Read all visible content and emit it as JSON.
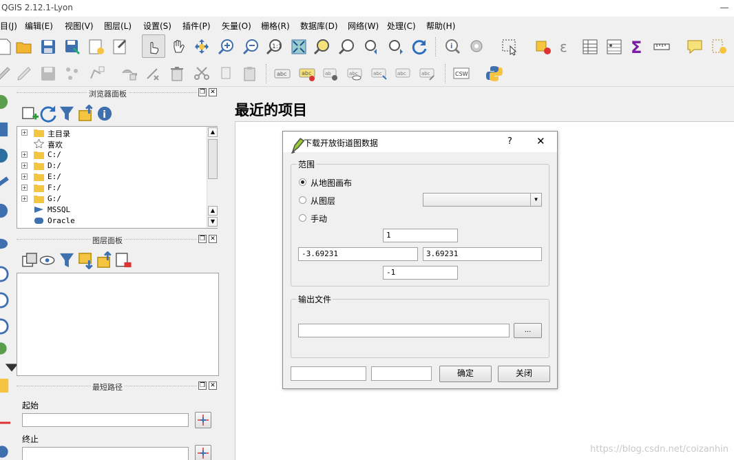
{
  "window": {
    "title": "QGIS 2.12.1-Lyon"
  },
  "menu": [
    {
      "label": "目(J)"
    },
    {
      "label": "编辑(E)"
    },
    {
      "label": "视图(V)"
    },
    {
      "label": "图层(L)"
    },
    {
      "label": "设置(S)"
    },
    {
      "label": "插件(P)"
    },
    {
      "label": "矢量(O)"
    },
    {
      "label": "栅格(R)"
    },
    {
      "label": "数据库(D)"
    },
    {
      "label": "网络(W)"
    },
    {
      "label": "处理(C)"
    },
    {
      "label": "帮助(H)"
    }
  ],
  "toolbar2": {
    "csw_label": "CSW"
  },
  "browser_panel": {
    "title": "浏览器面板",
    "items": [
      {
        "label": "主目录"
      },
      {
        "label": "喜欢"
      },
      {
        "label": "C:/"
      },
      {
        "label": "D:/"
      },
      {
        "label": "E:/"
      },
      {
        "label": "F:/"
      },
      {
        "label": "G:/"
      },
      {
        "label": "MSSQL"
      },
      {
        "label": "Oracle"
      }
    ]
  },
  "layers_panel": {
    "title": "图层面板"
  },
  "shortest_path_panel": {
    "title": "最短路径",
    "start_label": "起始",
    "end_label": "终止",
    "start_value": "",
    "end_value": ""
  },
  "recent_projects": {
    "title": "最近的项目"
  },
  "watermark": "https://blog.csdn.net/coizanhin",
  "dialog": {
    "title": "下载开放街道图数据",
    "help_label": "?",
    "close_icon_label": "✕",
    "extent_group": "范围",
    "radio_from_canvas": "从地图画布",
    "radio_from_layer": "从图层",
    "radio_manual": "手动",
    "layer_select_value": "",
    "north": "1",
    "west": "-3.69231",
    "east": "3.69231",
    "south": "-1",
    "output_group": "输出文件",
    "output_path": "",
    "browse_label": "...",
    "ok_label": "确定",
    "close_label": "关闭"
  }
}
